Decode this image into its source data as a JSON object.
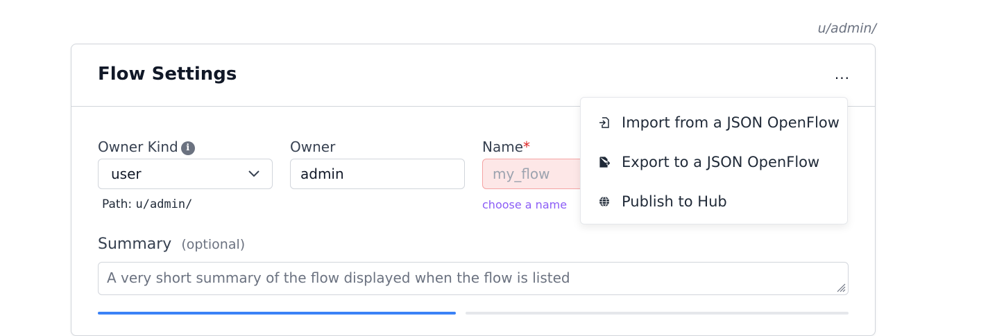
{
  "top_path": "u/admin/",
  "card": {
    "title": "Flow Settings",
    "more_label": "..."
  },
  "form": {
    "owner_kind": {
      "label": "Owner Kind",
      "value": "user",
      "info_icon": "info-icon"
    },
    "owner": {
      "label": "Owner",
      "value": "admin"
    },
    "name": {
      "label": "Name",
      "required_mark": "*",
      "placeholder": "my_flow",
      "hint": "choose a name"
    },
    "path": {
      "label": "Path:",
      "value": "u/admin/"
    },
    "summary": {
      "label": "Summary",
      "optional": "(optional)",
      "placeholder": "A very short summary of the flow displayed when the flow is listed"
    }
  },
  "menu": {
    "items": [
      {
        "label": "Import from a JSON OpenFlow",
        "icon": "file-import-icon"
      },
      {
        "label": "Export to a JSON OpenFlow",
        "icon": "file-export-icon"
      },
      {
        "label": "Publish to Hub",
        "icon": "globe-icon"
      }
    ]
  },
  "colors": {
    "accent": "#3b82f6",
    "error_bg": "#fde7e7",
    "hint": "#8b5cf6",
    "required": "#dc2626"
  }
}
